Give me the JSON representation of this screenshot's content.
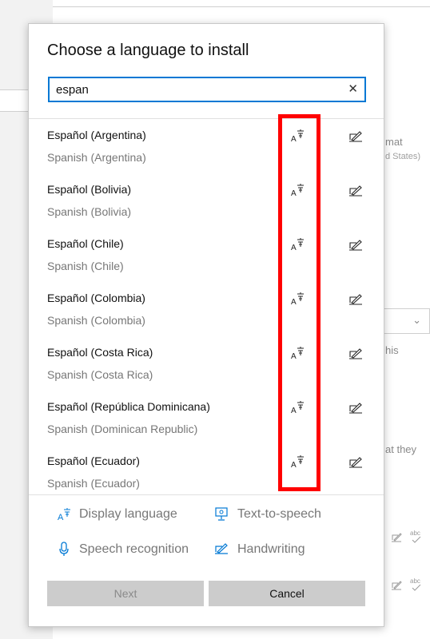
{
  "background": {
    "fragments": [
      "mat",
      "d States)",
      "his",
      "at they"
    ],
    "chevron": "⌄"
  },
  "dialog": {
    "title": "Choose a language to install",
    "search": {
      "value": "espan",
      "clear_glyph": "✕"
    },
    "languages": [
      {
        "name": "Español (Argentina)",
        "english": "Spanish (Argentina)"
      },
      {
        "name": "Español (Bolivia)",
        "english": "Spanish (Bolivia)"
      },
      {
        "name": "Español (Chile)",
        "english": "Spanish (Chile)"
      },
      {
        "name": "Español (Colombia)",
        "english": "Spanish (Colombia)"
      },
      {
        "name": "Español (Costa Rica)",
        "english": "Spanish (Costa Rica)"
      },
      {
        "name": "Español (República Dominicana)",
        "english": "Spanish (Dominican Republic)"
      },
      {
        "name": "Español (Ecuador)",
        "english": "Spanish (Ecuador)"
      }
    ],
    "legend": {
      "display_language": "Display language",
      "text_to_speech": "Text-to-speech",
      "speech_recognition": "Speech recognition",
      "handwriting": "Handwriting"
    },
    "buttons": {
      "next": "Next",
      "cancel": "Cancel"
    }
  },
  "icons": {
    "display_language": "display-language-icon",
    "handwriting": "handwriting-icon",
    "text_to_speech": "text-to-speech-icon",
    "speech_recognition": "microphone-icon",
    "spell_check": "spell-check-icon"
  },
  "colors": {
    "accent": "#0078d4",
    "highlight": "#ff0000",
    "button_bg": "#cccccc"
  }
}
